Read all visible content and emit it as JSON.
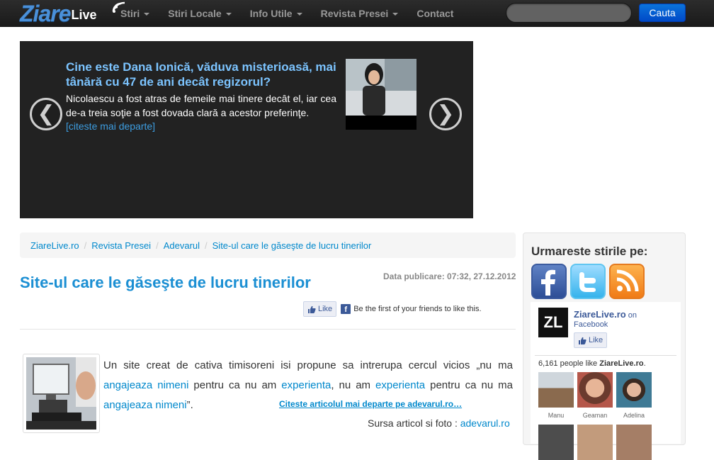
{
  "navbar": {
    "logo_main": "Ziare",
    "logo_sub": "Live",
    "menu": [
      {
        "label": "Stiri",
        "dropdown": true
      },
      {
        "label": "Stiri Locale",
        "dropdown": true
      },
      {
        "label": "Info Utile",
        "dropdown": true
      },
      {
        "label": "Revista Presei",
        "dropdown": true
      },
      {
        "label": "Contact",
        "dropdown": false
      }
    ],
    "search_placeholder": "",
    "search_button": "Cauta"
  },
  "carousel": {
    "title": "Cine este Dana Ionică, văduva misterioasă, mai tânără cu 47 de ani decât regizorul?",
    "text": "Nicolaescu a fost atras de femeile mai tinere decât el, iar cea de-a treia soţie a fost dovada clară a acestor preferinţe.",
    "more": "[citeste mai departe]",
    "prev": "❮",
    "next": "❯"
  },
  "breadcrumb": [
    "ZiareLive.ro",
    "Revista Presei",
    "Adevarul",
    "Site-ul care le găseşte de lucru tinerilor"
  ],
  "article": {
    "title": "Site-ul care le găseşte de lucru tinerilor",
    "date_label": "Data publicare: 07:32, 27.12.2012",
    "like_label": "Like",
    "like_text": "Be the first of your friends to like this.",
    "body_1": "Un site creat de cativa timisoreni isi propune sa intrerupa cercul vicios „nu ma ",
    "body_hl1": "angajeaza nimeni",
    "body_2": " pentru ca nu am ",
    "body_hl2": "experienta",
    "body_3": ", nu am ",
    "body_hl3": "experienta",
    "body_4": " pentru ca nu ma ",
    "body_hl4": "angajeaza nimeni",
    "body_5": "”.",
    "read_more": "Citeste articolul mai departe pe adevarul.ro…",
    "source_label": "Sursa articol si foto : ",
    "source_link": "adevarul.ro"
  },
  "sidebar": {
    "title": "Urmareste stirile pe:",
    "social": [
      "facebook-icon",
      "twitter-icon",
      "rss-icon"
    ],
    "fb_page": {
      "logo_text": "ZL",
      "name": "ZiareLive.ro",
      "on": " on",
      "facebook": "Facebook",
      "like": "Like",
      "count_prefix": "6,161 people like ",
      "count_page": "ZiareLive.ro",
      "count_suffix": "."
    },
    "fans": [
      {
        "name": "Manu",
        "color": "#8a6a4e"
      },
      {
        "name": "Geaman",
        "color": "#b5574a"
      },
      {
        "name": "Adelina",
        "color": "#3f7a95"
      },
      {
        "name": "",
        "color": "#4d4d4d"
      },
      {
        "name": "",
        "color": "#c29b7c"
      },
      {
        "name": "",
        "color": "#a57e66"
      }
    ]
  }
}
